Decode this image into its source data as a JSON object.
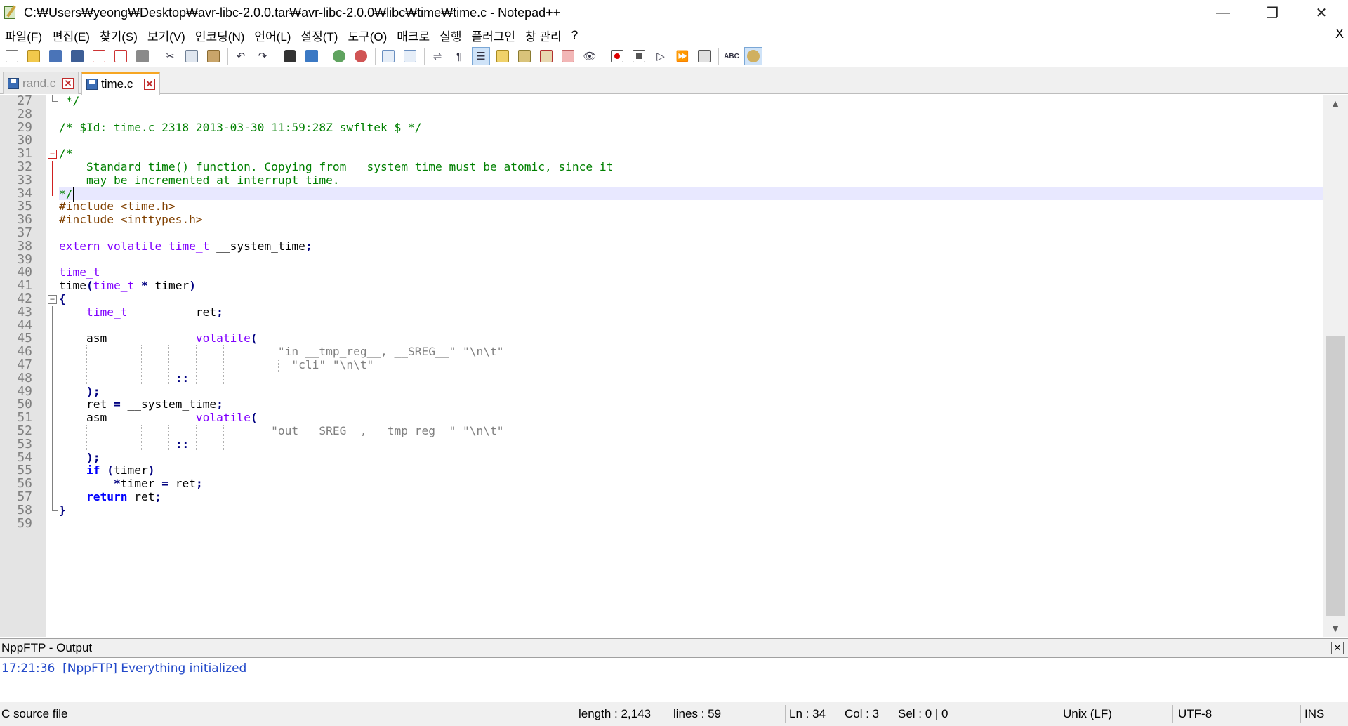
{
  "window": {
    "title": "C:₩Users₩yeong₩Desktop₩avr-libc-2.0.0.tar₩avr-libc-2.0.0₩libc₩time₩time.c - Notepad++",
    "minimize": "—",
    "maximize": "❐",
    "close": "✕"
  },
  "menu": {
    "items": [
      "파일(F)",
      "편집(E)",
      "찾기(S)",
      "보기(V)",
      "인코딩(N)",
      "언어(L)",
      "설정(T)",
      "도구(O)",
      "매크로",
      "실행",
      "플러그인",
      "창 관리",
      "?"
    ],
    "close_doc": "X"
  },
  "toolbar": {
    "icons": [
      "new-file-icon",
      "open-file-icon",
      "save-icon",
      "save-all-icon",
      "close-icon",
      "close-all-icon",
      "print-icon",
      "cut-icon",
      "copy-icon",
      "paste-icon",
      "undo-icon",
      "redo-icon",
      "find-icon",
      "replace-icon",
      "zoom-in-icon",
      "zoom-out-icon",
      "sync-vertical-icon",
      "sync-horizontal-icon",
      "word-wrap-icon",
      "show-all-chars-icon",
      "indent-guide-icon",
      "udl-icon",
      "doc-map-icon",
      "function-list-icon",
      "folder-workspace-icon",
      "monitor-icon",
      "macro-record-icon",
      "macro-stop-icon",
      "macro-play-icon",
      "macro-run-multiple-icon",
      "macro-save-icon",
      "spellcheck-icon",
      "nppftp-icon"
    ]
  },
  "tabs": [
    {
      "label": "rand.c",
      "active": false
    },
    {
      "label": "time.c",
      "active": true
    }
  ],
  "editor": {
    "current_line": 34,
    "lines": [
      {
        "n": "27",
        "tokens": [
          {
            "t": " */",
            "c": "c-comment"
          }
        ]
      },
      {
        "n": "28",
        "tokens": []
      },
      {
        "n": "29",
        "tokens": [
          {
            "t": "/* $Id: time.c 2318 2013-03-30 11:59:28Z swfltek $ */",
            "c": "c-comment"
          }
        ]
      },
      {
        "n": "30",
        "tokens": []
      },
      {
        "n": "31",
        "tokens": [
          {
            "t": "/*",
            "c": "c-comment"
          }
        ]
      },
      {
        "n": "32",
        "tokens": [
          {
            "t": "    Standard time() function. Copying from __system_time must be atomic, since it",
            "c": "c-comment"
          }
        ]
      },
      {
        "n": "33",
        "tokens": [
          {
            "t": "    may be incremented at interrupt time.",
            "c": "c-comment"
          }
        ]
      },
      {
        "n": "34",
        "tokens": [
          {
            "t": "*/",
            "c": "c-comment"
          }
        ],
        "caret": true
      },
      {
        "n": "35",
        "tokens": [
          {
            "t": "#include <time.h>",
            "c": "c-pre"
          }
        ]
      },
      {
        "n": "36",
        "tokens": [
          {
            "t": "#include <inttypes.h>",
            "c": "c-pre"
          }
        ]
      },
      {
        "n": "37",
        "tokens": []
      },
      {
        "n": "38",
        "tokens": [
          {
            "t": "extern",
            "c": "c-type"
          },
          {
            "t": " ",
            "c": "c-plain"
          },
          {
            "t": "volatile",
            "c": "c-type"
          },
          {
            "t": " ",
            "c": "c-plain"
          },
          {
            "t": "time_t",
            "c": "c-type"
          },
          {
            "t": " __system_time",
            "c": "c-plain"
          },
          {
            "t": ";",
            "c": "c-op"
          }
        ]
      },
      {
        "n": "39",
        "tokens": []
      },
      {
        "n": "40",
        "tokens": [
          {
            "t": "time_t",
            "c": "c-type"
          }
        ]
      },
      {
        "n": "41",
        "tokens": [
          {
            "t": "time",
            "c": "c-plain"
          },
          {
            "t": "(",
            "c": "c-op"
          },
          {
            "t": "time_t",
            "c": "c-type"
          },
          {
            "t": " ",
            "c": "c-plain"
          },
          {
            "t": "*",
            "c": "c-op"
          },
          {
            "t": " timer",
            "c": "c-plain"
          },
          {
            "t": ")",
            "c": "c-op"
          }
        ]
      },
      {
        "n": "42",
        "tokens": [
          {
            "t": "{",
            "c": "c-op"
          }
        ]
      },
      {
        "n": "43",
        "tokens": [
          {
            "t": "    ",
            "c": "c-plain"
          },
          {
            "t": "time_t",
            "c": "c-type"
          },
          {
            "t": "          ret",
            "c": "c-plain"
          },
          {
            "t": ";",
            "c": "c-op"
          }
        ]
      },
      {
        "n": "44",
        "tokens": []
      },
      {
        "n": "45",
        "tokens": [
          {
            "t": "    asm             ",
            "c": "c-plain"
          },
          {
            "t": "volatile",
            "c": "c-type"
          },
          {
            "t": "(",
            "c": "c-op"
          }
        ]
      },
      {
        "n": "46",
        "tokens": [
          {
            "t": "                                ",
            "c": "c-plain"
          },
          {
            "t": "\"in __tmp_reg__, __SREG__\" \"\\n\\t\"",
            "c": "c-str"
          }
        ]
      },
      {
        "n": "47",
        "tokens": [
          {
            "t": "                                  ",
            "c": "c-plain"
          },
          {
            "t": "\"cli\" \"\\n\\t\"",
            "c": "c-str"
          }
        ]
      },
      {
        "n": "48",
        "tokens": [
          {
            "t": "                 ",
            "c": "c-plain"
          },
          {
            "t": "::",
            "c": "c-op"
          }
        ]
      },
      {
        "n": "49",
        "tokens": [
          {
            "t": "    ",
            "c": "c-plain"
          },
          {
            "t": ");",
            "c": "c-op"
          }
        ]
      },
      {
        "n": "50",
        "tokens": [
          {
            "t": "    ret ",
            "c": "c-plain"
          },
          {
            "t": "=",
            "c": "c-op"
          },
          {
            "t": " __system_time",
            "c": "c-plain"
          },
          {
            "t": ";",
            "c": "c-op"
          }
        ]
      },
      {
        "n": "51",
        "tokens": [
          {
            "t": "    asm             ",
            "c": "c-plain"
          },
          {
            "t": "volatile",
            "c": "c-type"
          },
          {
            "t": "(",
            "c": "c-op"
          }
        ]
      },
      {
        "n": "52",
        "tokens": [
          {
            "t": "                               ",
            "c": "c-plain"
          },
          {
            "t": "\"out __SREG__, __tmp_reg__\" \"\\n\\t\"",
            "c": "c-str"
          }
        ]
      },
      {
        "n": "53",
        "tokens": [
          {
            "t": "                 ",
            "c": "c-plain"
          },
          {
            "t": "::",
            "c": "c-op"
          }
        ]
      },
      {
        "n": "54",
        "tokens": [
          {
            "t": "    ",
            "c": "c-plain"
          },
          {
            "t": ");",
            "c": "c-op"
          }
        ]
      },
      {
        "n": "55",
        "tokens": [
          {
            "t": "    ",
            "c": "c-plain"
          },
          {
            "t": "if",
            "c": "c-kw"
          },
          {
            "t": " ",
            "c": "c-plain"
          },
          {
            "t": "(",
            "c": "c-op"
          },
          {
            "t": "timer",
            "c": "c-plain"
          },
          {
            "t": ")",
            "c": "c-op"
          }
        ]
      },
      {
        "n": "56",
        "tokens": [
          {
            "t": "        ",
            "c": "c-plain"
          },
          {
            "t": "*",
            "c": "c-op"
          },
          {
            "t": "timer ",
            "c": "c-plain"
          },
          {
            "t": "=",
            "c": "c-op"
          },
          {
            "t": " ret",
            "c": "c-plain"
          },
          {
            "t": ";",
            "c": "c-op"
          }
        ]
      },
      {
        "n": "57",
        "tokens": [
          {
            "t": "    ",
            "c": "c-plain"
          },
          {
            "t": "return",
            "c": "c-kw"
          },
          {
            "t": " ret",
            "c": "c-plain"
          },
          {
            "t": ";",
            "c": "c-op"
          }
        ]
      },
      {
        "n": "58",
        "tokens": [
          {
            "t": "}",
            "c": "c-op"
          }
        ]
      },
      {
        "n": "59",
        "tokens": []
      }
    ]
  },
  "output_panel": {
    "title": "NppFTP - Output",
    "close": "✕",
    "message": "17:21:36  [NppFTP] Everything initialized"
  },
  "status": {
    "file_type": "C source file",
    "length": "length : 2,143",
    "lines": "lines : 59",
    "ln": "Ln : 34",
    "col": "Col : 3",
    "sel": "Sel : 0 | 0",
    "eol": "Unix (LF)",
    "encoding": "UTF-8",
    "mode": "INS"
  },
  "colors": {
    "comment": "#008000",
    "preprocessor": "#804000",
    "type": "#8000ff",
    "keyword": "#0000ff",
    "operator": "#000080",
    "string": "#808080",
    "current_line_bg": "#e8e8ff",
    "gutter_bg": "#e4e4e4"
  }
}
